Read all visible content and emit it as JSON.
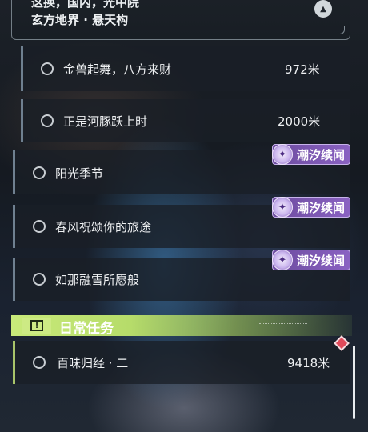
{
  "header": {
    "title": "这换，国内，光中院",
    "location": "玄方地界 · 悬天构",
    "collapse_icon": "chevron-up-icon"
  },
  "quests": [
    {
      "name": "金兽起舞，八方来财",
      "distance": "972米"
    },
    {
      "name": "正是河豚跃上时",
      "distance": "2000米"
    },
    {
      "name": "阳光季节",
      "badge": "潮汐续闻"
    },
    {
      "name": "春风祝颂你的旅途",
      "badge": "潮汐续闻"
    },
    {
      "name": "如那融雪所愿般",
      "badge": "潮汐续闻"
    }
  ],
  "daily": {
    "title": "日常任务",
    "icon": "exclamation-icon",
    "accent": "#c9ea7a",
    "items": [
      {
        "name": "百味归经 · 二",
        "distance": "9418米"
      }
    ]
  },
  "colors": {
    "badge_purple": "#8a62c2",
    "tracked_marker": "#e04a5a"
  }
}
